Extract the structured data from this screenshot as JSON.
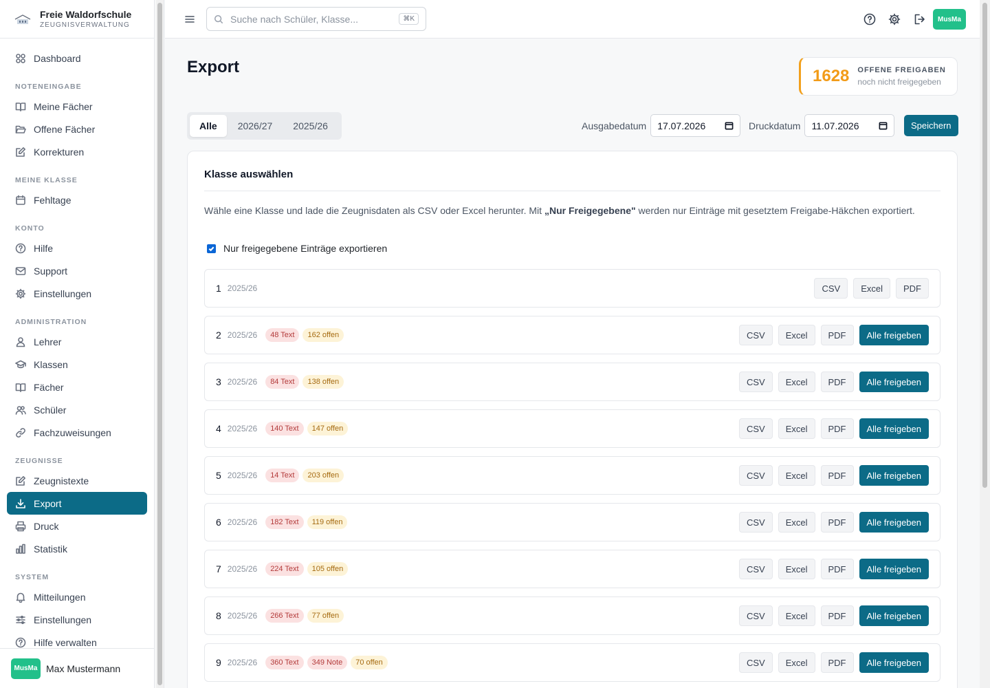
{
  "brand": {
    "title": "Freie Waldorfschule",
    "subtitle": "ZEUGNISVERWALTUNG"
  },
  "sidebar": {
    "dashboard": "Dashboard",
    "sections": {
      "noteneingabe": "NOTENEINGABE",
      "meine_klasse": "MEINE KLASSE",
      "konto": "KONTO",
      "administration": "ADMINISTRATION",
      "zeugnisse": "ZEUGNISSE",
      "system": "SYSTEM"
    },
    "items": {
      "meine_faecher": "Meine Fächer",
      "offene_faecher": "Offene Fächer",
      "korrekturen": "Korrekturen",
      "fehltage": "Fehltage",
      "hilfe": "Hilfe",
      "support": "Support",
      "einstellungen": "Einstellungen",
      "lehrer": "Lehrer",
      "klassen": "Klassen",
      "faecher": "Fächer",
      "schueler": "Schüler",
      "fachzuweisungen": "Fachzuweisungen",
      "zeugnistexte": "Zeugnistexte",
      "export": "Export",
      "druck": "Druck",
      "statistik": "Statistik",
      "mitteilungen": "Mitteilungen",
      "system_einstellungen": "Einstellungen",
      "hilfe_verwalten": "Hilfe verwalten"
    },
    "active_color": "#0c6b87"
  },
  "user": {
    "initials": "MusMa",
    "name": "Max Mustermann",
    "avatar_color": "#22c08a"
  },
  "search": {
    "placeholder": "Suche nach Schüler, Klasse...",
    "shortcut": "⌘K"
  },
  "page": {
    "title": "Export"
  },
  "stat": {
    "value": "1628",
    "label": "OFFENE FREIGABEN",
    "sub": "noch nicht freigegeben",
    "accent": "#f29b18"
  },
  "tabs": [
    "Alle",
    "2026/27",
    "2025/26"
  ],
  "dates": {
    "ausgabe_label": "Ausgabedatum",
    "ausgabe_value": "17.07.2026",
    "druck_label": "Druckdatum",
    "druck_value": "11.07.2026",
    "save_label": "Speichern"
  },
  "panel": {
    "title": "Klasse auswählen",
    "desc_1": "Wähle eine Klasse und lade die Zeugnisdaten als CSV oder Excel herunter. Mit ",
    "desc_bold": "„Nur Freigegebene\"",
    "desc_2": " werden nur Einträge mit gesetztem Freigabe-Häkchen exportiert.",
    "checkbox_label": "Nur freigegebene Einträge exportieren",
    "checkbox_checked": true
  },
  "buttons": {
    "csv": "CSV",
    "excel": "Excel",
    "pdf": "PDF",
    "release_all": "Alle freigeben"
  },
  "classes": [
    {
      "num": "1",
      "year": "2025/26",
      "text": "",
      "note": "",
      "open": "",
      "release": false
    },
    {
      "num": "2",
      "year": "2025/26",
      "text": "48 Text",
      "note": "",
      "open": "162 offen",
      "release": true
    },
    {
      "num": "3",
      "year": "2025/26",
      "text": "84 Text",
      "note": "",
      "open": "138 offen",
      "release": true
    },
    {
      "num": "4",
      "year": "2025/26",
      "text": "140 Text",
      "note": "",
      "open": "147 offen",
      "release": true
    },
    {
      "num": "5",
      "year": "2025/26",
      "text": "14 Text",
      "note": "",
      "open": "203 offen",
      "release": true
    },
    {
      "num": "6",
      "year": "2025/26",
      "text": "182 Text",
      "note": "",
      "open": "119 offen",
      "release": true
    },
    {
      "num": "7",
      "year": "2025/26",
      "text": "224 Text",
      "note": "",
      "open": "105 offen",
      "release": true
    },
    {
      "num": "8",
      "year": "2025/26",
      "text": "266 Text",
      "note": "",
      "open": "77 offen",
      "release": true
    },
    {
      "num": "9",
      "year": "2025/26",
      "text": "360 Text",
      "note": "349 Note",
      "open": "70 offen",
      "release": true
    }
  ]
}
